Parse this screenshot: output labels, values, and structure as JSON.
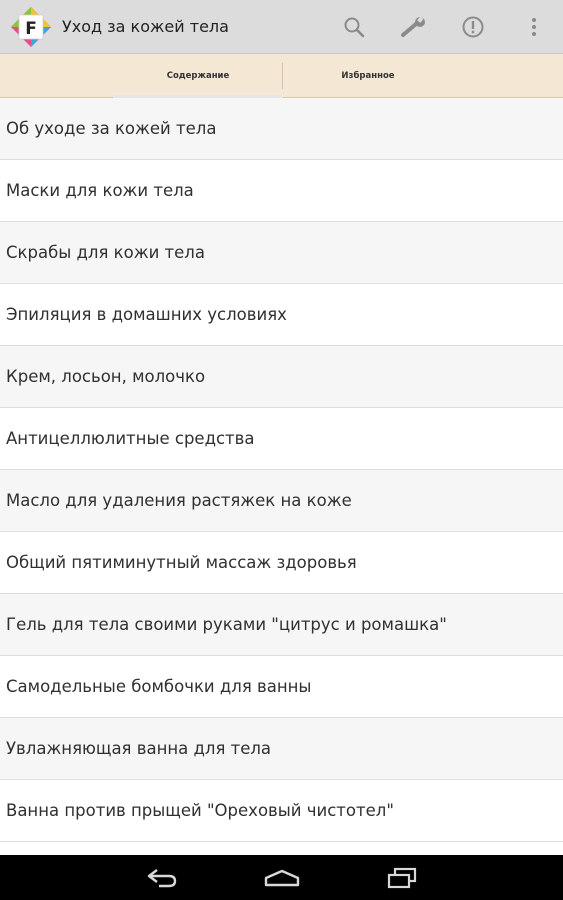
{
  "app": {
    "icon_letter": "F",
    "title": "Уход за кожей тела"
  },
  "action_bar": {
    "icons": [
      "search-icon",
      "wrench-icon",
      "info-icon",
      "overflow-menu-icon"
    ]
  },
  "tabs": [
    {
      "label": "Содержание",
      "selected": true
    },
    {
      "label": "Избранное",
      "selected": false
    }
  ],
  "list": {
    "items": [
      "Об уходе за кожей тела",
      "Маски для кожи тела",
      "Скрабы для кожи тела",
      "Эпиляция в домашних условиях",
      "Крем, лосьон, молочко",
      "Антицеллюлитные средства",
      "Масло для удаления растяжек на коже",
      "Общий пятиминутный массаж здоровья",
      "Гель для тела своими руками \"цитрус и ромашка\"",
      "Самодельные бомбочки для ванны",
      "Увлажняющая ванна для тела",
      "Ванна против прыщей \"Ореховый чистотел\""
    ]
  },
  "nav_bar": {
    "icons": [
      "back-icon",
      "home-icon",
      "recent-apps-icon"
    ]
  },
  "colors": {
    "action_bar": "#dcdcdc",
    "tab_bar": "#f4e7d3",
    "nav_bar": "#000000"
  }
}
